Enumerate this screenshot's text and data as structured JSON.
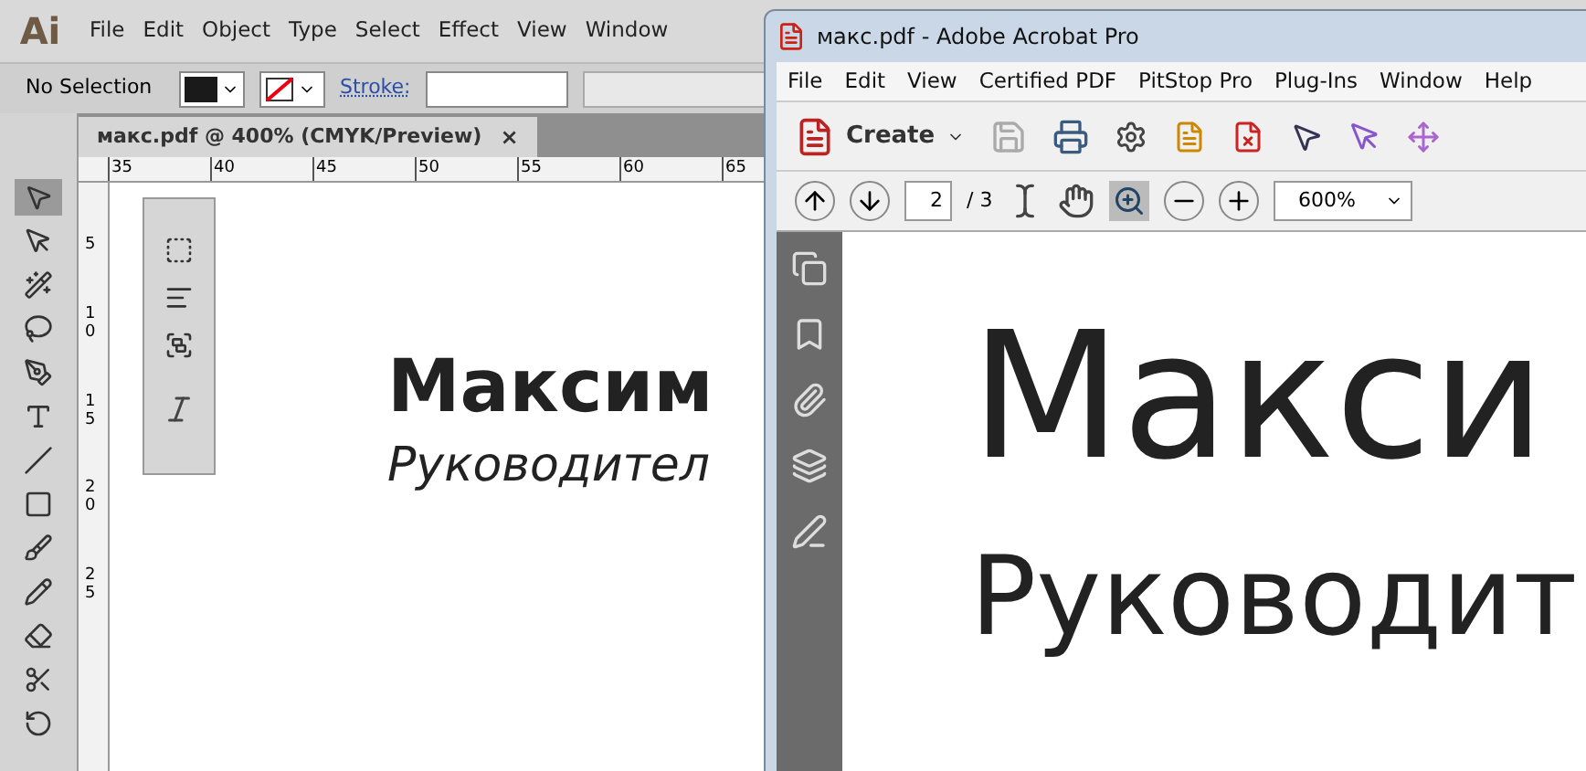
{
  "illustrator": {
    "logo": "Ai",
    "menu": [
      "File",
      "Edit",
      "Object",
      "Type",
      "Select",
      "Effect",
      "View",
      "Window"
    ],
    "control_bar": {
      "selection": "No Selection",
      "stroke_label": "Stroke:"
    },
    "document_tab": {
      "title": "макс.pdf @ 400% (CMYK/Preview)",
      "close": "×"
    },
    "ruler_h": [
      "35",
      "40",
      "45",
      "50",
      "55",
      "60",
      "65"
    ],
    "ruler_v": [
      "5",
      "10",
      "15",
      "20",
      "25"
    ],
    "canvas": {
      "name": "Максим",
      "role": "Руководител"
    }
  },
  "acrobat": {
    "title": "макс.pdf - Adobe Acrobat Pro",
    "menu": [
      "File",
      "Edit",
      "View",
      "Certified PDF",
      "PitStop Pro",
      "Plug-Ins",
      "Window",
      "Help"
    ],
    "create": "Create",
    "page": "2",
    "page_total": "/ 3",
    "zoom": "600%",
    "canvas": {
      "name": "Макси",
      "role": "Руководит"
    }
  }
}
